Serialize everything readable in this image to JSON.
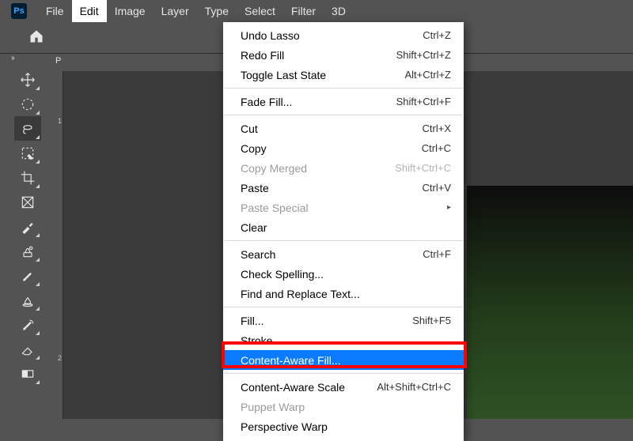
{
  "app": {
    "logo_text": "Ps"
  },
  "menubar": {
    "items": [
      "File",
      "Edit",
      "Image",
      "Layer",
      "Type",
      "Select",
      "Filter",
      "3D"
    ]
  },
  "toolbar": {
    "expand_chevrons": "››",
    "tools": [
      {
        "name": "move-tool"
      },
      {
        "name": "marquee-tool"
      },
      {
        "name": "lasso-tool"
      },
      {
        "name": "quick-select-tool"
      },
      {
        "name": "crop-tool"
      },
      {
        "name": "frame-tool"
      },
      {
        "name": "eyedropper-tool"
      },
      {
        "name": "healing-brush-tool"
      },
      {
        "name": "brush-tool"
      },
      {
        "name": "clone-stamp-tool"
      },
      {
        "name": "history-brush-tool"
      },
      {
        "name": "eraser-tool"
      },
      {
        "name": "gradient-tool"
      }
    ]
  },
  "panel": {
    "tab_stub": "P"
  },
  "ruler": {
    "ticks": [
      "1",
      "2"
    ]
  },
  "edit_menu": {
    "groups": [
      [
        {
          "label": "Undo Lasso",
          "shortcut": "Ctrl+Z",
          "enabled": true
        },
        {
          "label": "Redo Fill",
          "shortcut": "Shift+Ctrl+Z",
          "enabled": true
        },
        {
          "label": "Toggle Last State",
          "shortcut": "Alt+Ctrl+Z",
          "enabled": true
        }
      ],
      [
        {
          "label": "Fade Fill...",
          "shortcut": "Shift+Ctrl+F",
          "enabled": true
        }
      ],
      [
        {
          "label": "Cut",
          "shortcut": "Ctrl+X",
          "enabled": true
        },
        {
          "label": "Copy",
          "shortcut": "Ctrl+C",
          "enabled": true
        },
        {
          "label": "Copy Merged",
          "shortcut": "Shift+Ctrl+C",
          "enabled": false
        },
        {
          "label": "Paste",
          "shortcut": "Ctrl+V",
          "enabled": true
        },
        {
          "label": "Paste Special",
          "shortcut": "",
          "enabled": false,
          "submenu": true
        },
        {
          "label": "Clear",
          "shortcut": "",
          "enabled": true
        }
      ],
      [
        {
          "label": "Search",
          "shortcut": "Ctrl+F",
          "enabled": true
        },
        {
          "label": "Check Spelling...",
          "shortcut": "",
          "enabled": true
        },
        {
          "label": "Find and Replace Text...",
          "shortcut": "",
          "enabled": true
        }
      ],
      [
        {
          "label": "Fill...",
          "shortcut": "Shift+F5",
          "enabled": true
        },
        {
          "label": "Stroke...",
          "shortcut": "",
          "enabled": true
        },
        {
          "label": "Content-Aware Fill...",
          "shortcut": "",
          "enabled": true,
          "selected": true
        }
      ],
      [
        {
          "label": "Content-Aware Scale",
          "shortcut": "Alt+Shift+Ctrl+C",
          "enabled": true
        },
        {
          "label": "Puppet Warp",
          "shortcut": "",
          "enabled": false
        },
        {
          "label": "Perspective Warp",
          "shortcut": "",
          "enabled": true
        }
      ]
    ]
  }
}
